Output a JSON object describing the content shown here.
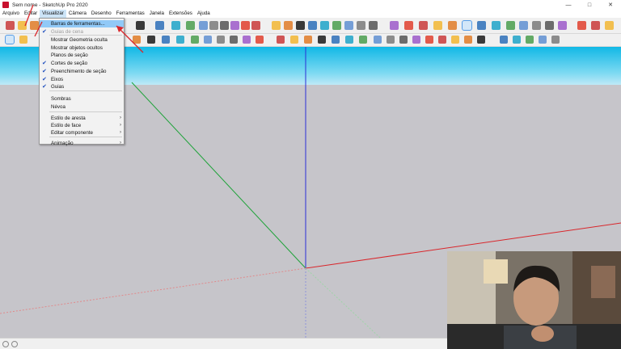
{
  "window": {
    "title": "Sem nome - SketchUp Pro 2020",
    "app_icon": "sketchup-icon",
    "controls": [
      "minimize-icon",
      "maximize-icon",
      "close-icon"
    ]
  },
  "menubar": {
    "items": [
      "Arquivo",
      "Editar",
      "Visualizar",
      "Câmera",
      "Desenho",
      "Ferramentas",
      "Janela",
      "Extensões",
      "Ajuda"
    ],
    "active": "Visualizar"
  },
  "visualizar_menu": {
    "items": [
      {
        "label": "Barras de ferramentas...",
        "highlighted": true
      },
      {
        "label": "Guias de cena",
        "disabled": true,
        "checked": true
      },
      {
        "label": "Mostrar Geometria oculta"
      },
      {
        "label": "Mostrar objetos ocultos"
      },
      {
        "label": "Planos de seção"
      },
      {
        "label": "Cortes de seção",
        "checked": true
      },
      {
        "label": "Preenchimento de seção",
        "checked": true
      },
      {
        "label": "Eixos",
        "checked": true
      },
      {
        "label": "Guias",
        "checked": true
      },
      {
        "label": "Sombras"
      },
      {
        "label": "Névoa"
      },
      {
        "label": "Estilo de aresta",
        "submenu": true
      },
      {
        "label": "Estilo de face",
        "submenu": true
      },
      {
        "label": "Editar componente",
        "submenu": true
      },
      {
        "label": "Animação",
        "submenu": true
      }
    ]
  },
  "viewport": {
    "sky_color": "#11b8e6",
    "ground_color": "#c6c5ca",
    "axis_colors": {
      "red": "#d9262b",
      "green": "#1fa33a",
      "blue": "#2b2fd6"
    }
  },
  "annotation_color": "#d9262b",
  "webcam": {
    "description_icon": "webcam-overlay"
  }
}
